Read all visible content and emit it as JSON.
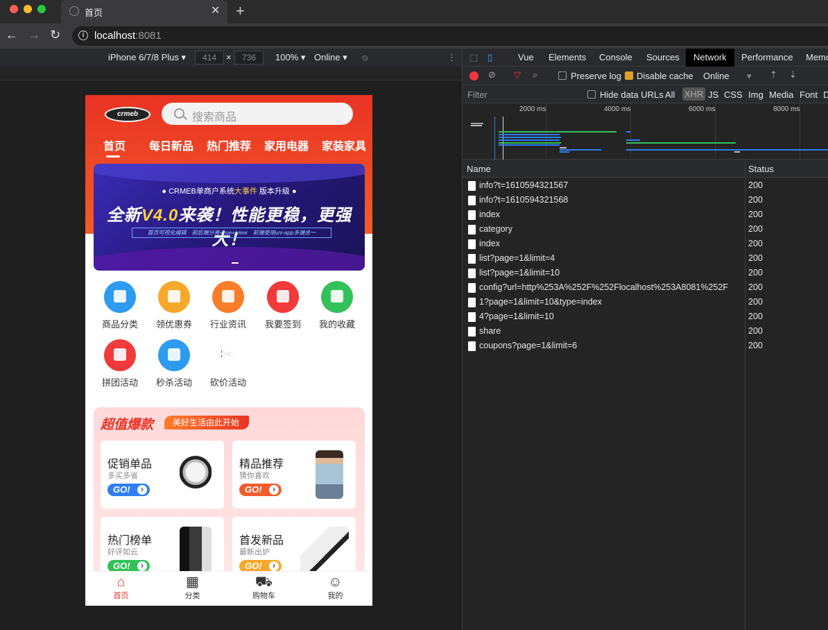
{
  "browser": {
    "tab_title": "首页",
    "url_host": "localhost",
    "url_port": ":8081"
  },
  "device_toolbar": {
    "device": "iPhone 6/7/8 Plus",
    "width": "414",
    "times": "×",
    "height": "736",
    "zoom": "100%",
    "network": "Online"
  },
  "app": {
    "logo_text": "crmeb",
    "search_placeholder": "搜索商品",
    "nav": [
      "首页",
      "每日新品",
      "热门推荐",
      "家用电器",
      "家装家具"
    ],
    "banner": {
      "line1_a": "● CRMEB单商户系统",
      "line1_b": "大事件",
      "line1_c": "版本升级 ●",
      "line2_a": "全新",
      "line2_b": "V4.0",
      "line2_c": "来袭！性能更稳，更强大！",
      "line3": "首页可视化编辑　前后端分离+vue+iview　前端使用uni-app多端合一"
    },
    "menus": [
      {
        "label": "商品分类",
        "color": "#2d9bf0"
      },
      {
        "label": "领优惠券",
        "color": "#f7a82a"
      },
      {
        "label": "行业资讯",
        "color": "#fa7d27"
      },
      {
        "label": "我要签到",
        "color": "#f23a3a"
      },
      {
        "label": "我的收藏",
        "color": "#33c25a"
      },
      {
        "label": "拼团活动",
        "color": "#f23a3a"
      },
      {
        "label": "秒杀活动",
        "color": "#2d9bf0"
      },
      {
        "label": "砍价活动",
        "color": "#ffffff"
      }
    ],
    "promo": {
      "title": "超值爆款",
      "tag": "美好生活由此开始",
      "cards": [
        {
          "title": "促销单品",
          "sub": "多买多省",
          "go": "GO!",
          "go_color": "#2d7ff0"
        },
        {
          "title": "精品推荐",
          "sub": "猜你喜欢",
          "go": "GO!",
          "go_color": "#f25c2a"
        },
        {
          "title": "热门榜单",
          "sub": "好评如云",
          "go": "GO!",
          "go_color": "#33c25a"
        },
        {
          "title": "首发新品",
          "sub": "最新出炉",
          "go": "GO!",
          "go_color": "#f7a82a"
        }
      ]
    },
    "tabbar": [
      {
        "label": "首页",
        "icon": "home-icon",
        "active": true
      },
      {
        "label": "分类",
        "icon": "grid-icon",
        "active": false
      },
      {
        "label": "购物车",
        "icon": "cart-icon",
        "active": false
      },
      {
        "label": "我的",
        "icon": "user-icon",
        "active": false
      }
    ]
  },
  "devtools": {
    "tabs": [
      "Vue",
      "Elements",
      "Console",
      "Sources",
      "Network",
      "Performance",
      "Memo"
    ],
    "active_tab": "Network",
    "preserve_log": "Preserve log",
    "disable_cache": "Disable cache",
    "throttle": "Online",
    "filter_placeholder": "Filter",
    "hide_data_urls": "Hide data URLs",
    "type_filters": [
      "All",
      "XHR",
      "JS",
      "CSS",
      "Img",
      "Media",
      "Font",
      "D"
    ],
    "active_type": "XHR",
    "timeline_ticks": [
      "2000 ms",
      "4000 ms",
      "6000 ms",
      "8000 ms"
    ],
    "col_name": "Name",
    "col_status": "Status",
    "requests": [
      {
        "name": "info?t=1610594321567",
        "status": "200"
      },
      {
        "name": "info?t=1610594321568",
        "status": "200"
      },
      {
        "name": "index",
        "status": "200"
      },
      {
        "name": "category",
        "status": "200"
      },
      {
        "name": "index",
        "status": "200"
      },
      {
        "name": "list?page=1&limit=4",
        "status": "200"
      },
      {
        "name": "list?page=1&limit=10",
        "status": "200"
      },
      {
        "name": "config?url=http%253A%252F%252Flocalhost%253A8081%252F",
        "status": "200"
      },
      {
        "name": "1?page=1&limit=10&type=index",
        "status": "200"
      },
      {
        "name": "4?page=1&limit=10",
        "status": "200"
      },
      {
        "name": "share",
        "status": "200"
      },
      {
        "name": "coupons?page=1&limit=6",
        "status": "200"
      }
    ]
  }
}
